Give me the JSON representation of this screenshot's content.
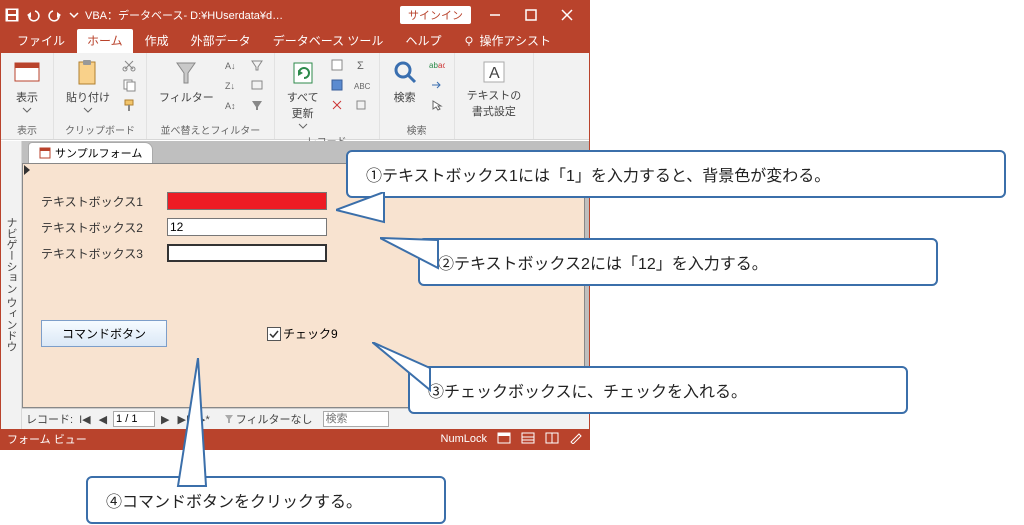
{
  "titlebar": {
    "title": "VBA：データベース- D:¥HUserdata¥d…",
    "signin": "サインイン"
  },
  "tabs": {
    "file": "ファイル",
    "home": "ホーム",
    "create": "作成",
    "external": "外部データ",
    "dbtools": "データベース ツール",
    "help": "ヘルプ",
    "assist": "操作アシスト"
  },
  "ribbon": {
    "group_view": "表示",
    "btn_view": "表示",
    "group_clipboard": "クリップボード",
    "btn_paste": "貼り付け",
    "group_sortfilter": "並べ替えとフィルター",
    "btn_filter": "フィルター",
    "group_records": "レコード",
    "btn_refresh": "すべて\n更新",
    "group_find": "検索",
    "btn_find": "検索",
    "group_textfmt": "テキストの\n書式設定"
  },
  "navpane": "ナビゲーション ウィンドウ",
  "doctab": "サンプルフォーム",
  "form": {
    "lbl1": "テキストボックス1",
    "lbl2": "テキストボックス2",
    "lbl3": "テキストボックス3",
    "val1": "",
    "val2": "12",
    "val3": "",
    "cmd": "コマンドボタン",
    "chk": "チェック9"
  },
  "recnav": {
    "label": "レコード:",
    "pos": "1 / 1",
    "filter": "フィルターなし",
    "search": "検索"
  },
  "status": {
    "left": "フォーム ビュー",
    "numlock": "NumLock"
  },
  "callouts": {
    "c1": "①テキストボックス1には「1」を入力すると、背景色が変わる。",
    "c2": "②テキストボックス2には「12」を入力する。",
    "c3": "③チェックボックスに、チェックを入れる。",
    "c4": "④コマンドボタンをクリックする。"
  }
}
